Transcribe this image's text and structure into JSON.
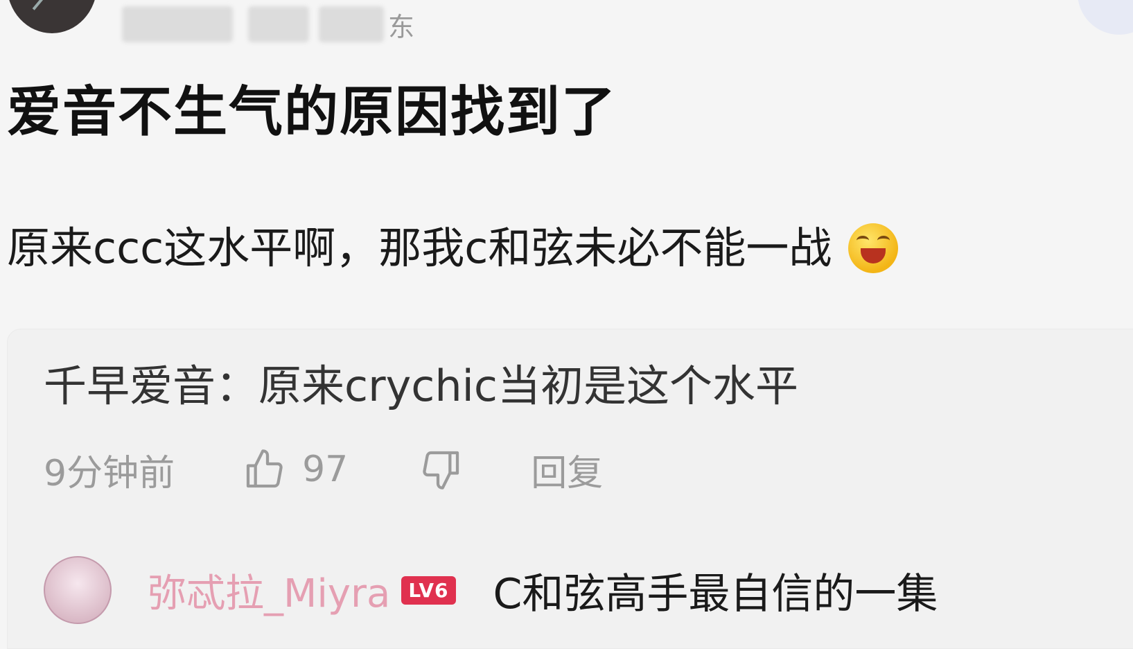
{
  "header": {
    "location": "东"
  },
  "post": {
    "title": "爱音不生气的原因找到了",
    "body": "原来ccc这水平啊，那我c和弦未必不能一战"
  },
  "reply": {
    "quote": "千早爱音：原来crychic当初是这个水平",
    "time": "9分钟前",
    "likes": "97",
    "reply_label": "回复"
  },
  "subreply": {
    "username": "弥忒拉_Miyra",
    "level": "LV6",
    "text": "C和弦高手最自信的一集"
  },
  "icons": {
    "like": "thumbs-up-icon",
    "dislike": "thumbs-down-icon",
    "emoji": "laughing-emoji-icon"
  },
  "colors": {
    "username_pink": "#e59fb2",
    "level_badge": "#e0314f",
    "meta_gray": "#9b9b9b"
  }
}
